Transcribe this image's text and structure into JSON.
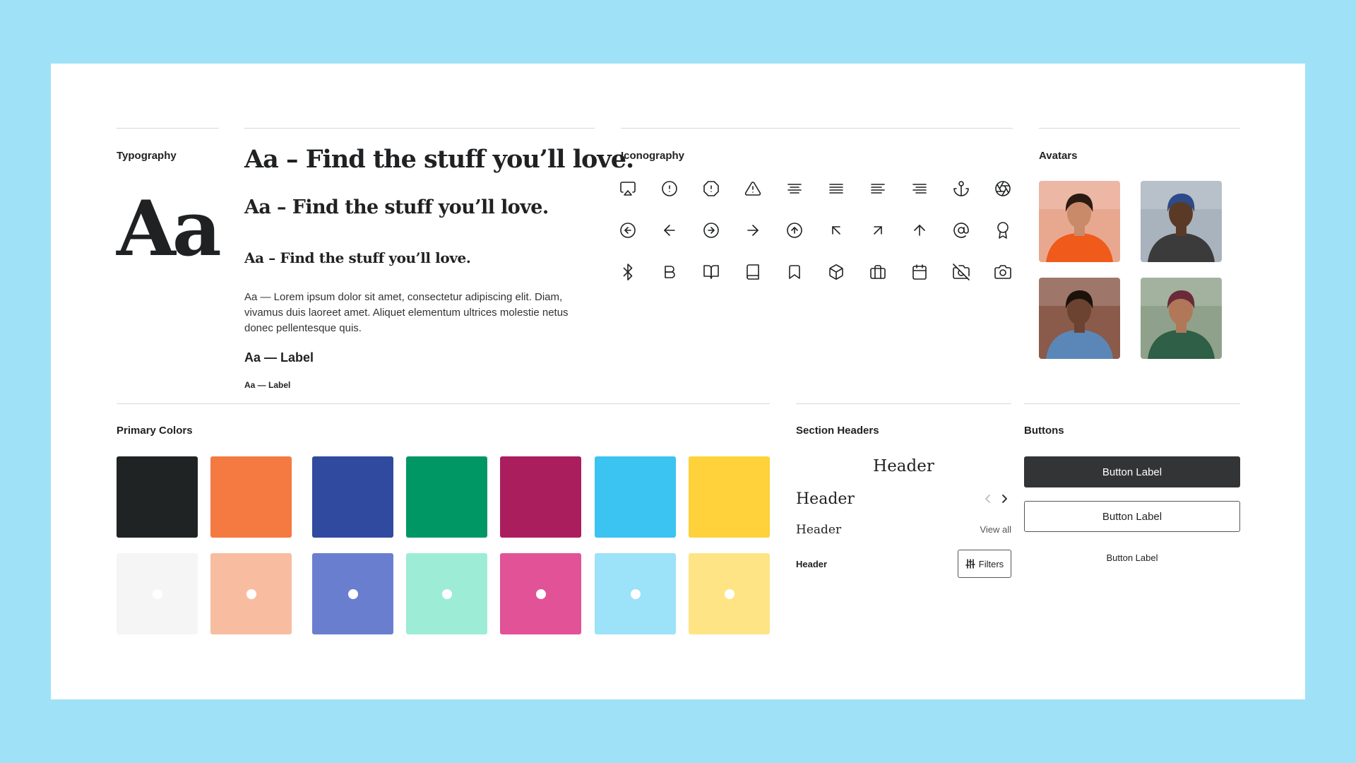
{
  "typography": {
    "title": "Typography",
    "aa": "Aa",
    "heading1": "Aa – Find the stuff you’ll love.",
    "heading2": "Aa – Find the stuff you’ll love.",
    "heading3": "Aa – Find the stuff you’ll love.",
    "body": "Aa — Lorem ipsum dolor sit amet, consectetur adipiscing elit. Diam, vivamus duis laoreet amet. Aliquet elementum ultrices molestie netus donec pellentesque quis.",
    "label_large": "Aa — Label",
    "label_small": "Aa — Label"
  },
  "iconography": {
    "title": "Iconography",
    "icons": [
      "airplay-icon",
      "alert-circle-icon",
      "alert-octagon-icon",
      "alert-triangle-icon",
      "align-center-icon",
      "align-justify-icon",
      "align-left-icon",
      "align-right-icon",
      "anchor-icon",
      "aperture-icon",
      "arrow-left-circle-icon",
      "arrow-left-icon",
      "arrow-right-circle-icon",
      "arrow-right-icon",
      "arrow-up-circle-icon",
      "arrow-up-left-icon",
      "arrow-up-right-icon",
      "arrow-up-icon",
      "at-sign-icon",
      "award-icon",
      "bluetooth-icon",
      "bold-icon",
      "book-open-icon",
      "book-icon",
      "bookmark-icon",
      "box-icon",
      "briefcase-icon",
      "calendar-icon",
      "camera-off-icon",
      "camera-icon"
    ]
  },
  "avatars": {
    "title": "Avatars",
    "items": [
      {
        "name": "avatar-woman-orange-sweater",
        "bg": "#e8a890",
        "shirt": "#f05a1a",
        "skin": "#c98a6a",
        "hair": "#2a1a12"
      },
      {
        "name": "avatar-man-blue-cap",
        "bg": "#a9b3bd",
        "shirt": "#3b3b3b",
        "skin": "#5a3a26",
        "hair": "#2d4a8a"
      },
      {
        "name": "avatar-woman-denim",
        "bg": "#8a5a4a",
        "shirt": "#5a87b8",
        "skin": "#6b4330",
        "hair": "#1c120c"
      },
      {
        "name": "avatar-man-glasses",
        "bg": "#8fa18a",
        "shirt": "#2f5f46",
        "skin": "#b07858",
        "hair": "#6a2a3a"
      }
    ]
  },
  "colors": {
    "title": "Primary Colors",
    "primary": [
      "#202324",
      "#f47a42",
      "#2f4a9f",
      "#009764",
      "#ab1e5e",
      "#3bc3f1",
      "#ffd13b"
    ],
    "light": [
      "#f5f5f5",
      "#f8bda1",
      "#6a7ed0",
      "#9decd6",
      "#e15297",
      "#9ce2f8",
      "#ffe485"
    ]
  },
  "section_headers": {
    "title": "Section Headers",
    "centered": "Header",
    "h2": "Header",
    "h3": "Header",
    "h4": "Header",
    "view_all": "View all",
    "filters_label": "Filters",
    "chevron_left": "chevron-left-icon",
    "chevron_right": "chevron-right-icon"
  },
  "buttons": {
    "title": "Buttons",
    "primary": "Button Label",
    "secondary": "Button Label",
    "text": "Button Label"
  }
}
